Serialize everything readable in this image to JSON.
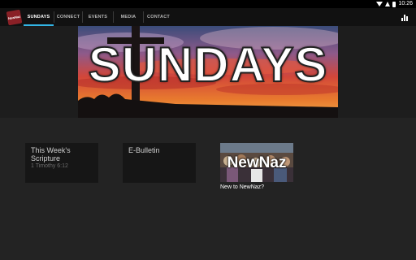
{
  "status_bar": {
    "time": "10:26"
  },
  "app": {
    "logo_text": "NewNaz",
    "tabs": [
      {
        "label": "SUNDAYS",
        "active": true
      },
      {
        "label": "CONNECT",
        "active": false
      },
      {
        "label": "EVENTS",
        "active": false
      },
      {
        "label": "MEDIA",
        "active": false
      },
      {
        "label": "CONTACT",
        "active": false
      }
    ],
    "accent_color": "#33b5e5"
  },
  "hero": {
    "title": "SUNDAYS"
  },
  "cards": [
    {
      "title": "This Week's Scripture",
      "subtitle": "1 Timothy 6:12"
    },
    {
      "title": "E-Bulletin",
      "subtitle": ""
    }
  ],
  "feature": {
    "image_text": "NewNaz",
    "caption": "New to NewNaz?"
  }
}
